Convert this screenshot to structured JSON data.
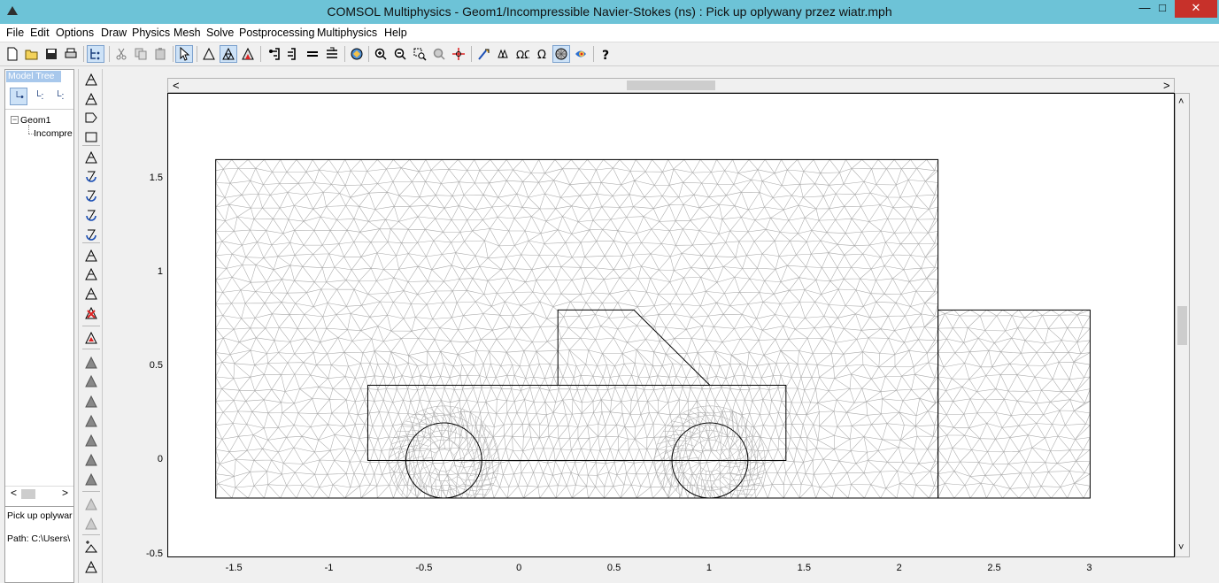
{
  "window": {
    "title": "COMSOL Multiphysics - Geom1/Incompressible Navier-Stokes (ns) : Pick up oplywany przez wiatr.mph",
    "minimize_glyph": "—",
    "maximize_glyph": "□",
    "close_glyph": "✕",
    "app_icon": "comsol-logo-icon"
  },
  "menu": {
    "items": [
      "File",
      "Edit",
      "Options",
      "Draw",
      "Physics",
      "Mesh",
      "Solve",
      "Postprocessing",
      "Multiphysics",
      "Help"
    ]
  },
  "toolbar": {
    "buttons": [
      "new-icon",
      "open-icon",
      "save-icon",
      "print-icon",
      "model-tree-icon",
      "cut-icon",
      "copy-icon",
      "paste-icon",
      "select-icon",
      "draw-mode-icon",
      "mesh-mode-icon",
      "postprocess-mode-icon",
      "scroll-icon",
      "zoom-in-step-icon",
      "equal-icon",
      "sub-equal-icon",
      "refresh-icon",
      "zoom-in-icon",
      "zoom-out-icon",
      "zoom-window-icon",
      "zoom-extents-icon",
      "move-icon",
      "plot-parameters-icon",
      "initialize-mesh-icon",
      "refine-mesh-icon",
      "omega-icon",
      "mesh-visible-icon",
      "color-plot-icon",
      "help-icon"
    ],
    "pressed": [
      "model-tree-icon",
      "select-icon",
      "mesh-mode-icon",
      "mesh-visible-icon"
    ]
  },
  "model_tree": {
    "header": "Model Tree",
    "tabs": [
      "└•",
      "└:",
      "└:"
    ],
    "nodes": [
      {
        "label": "Geom1",
        "expander": "−"
      },
      {
        "label": "Incompre"
      }
    ],
    "scroll_left": "<",
    "scroll_right": ">",
    "model_name": "Pick up oplywar",
    "path": "Path: C:\\Users\\"
  },
  "drawbar": {
    "buttons": [
      "draw-line-icon",
      "draw-triangle-icon",
      "draw-polygon-icon",
      "draw-square-icon",
      "mesh-boundary-icon",
      "rotate-mesh-icon",
      "rotate-mesh-2-icon",
      "rotate-mesh-3-icon",
      "rotate-mesh-4-icon",
      "extrude-mesh-icon",
      "refine-tri-icon",
      "refine-tri-2-icon",
      "delete-mesh-icon",
      "mesh-stats-icon",
      "solid-triangle-icon",
      "solid-flag-icon",
      "solid-square-icon",
      "solid-house-icon",
      "solid-triangle-2-icon",
      "solid-triangle-3-icon",
      "solid-triangle-4-icon",
      "outline-triangle-icon",
      "outline-triangle-2-icon",
      "add-point-icon",
      "edge-triangle-icon"
    ]
  },
  "canvas": {
    "scroll_left": "<",
    "scroll_right": ">",
    "scroll_up": "˄",
    "scroll_down": "˅",
    "x_ticks": [
      "-1.5",
      "-1",
      "-0.5",
      "0",
      "0.5",
      "1",
      "1.5",
      "2",
      "2.5",
      "3"
    ],
    "y_ticks": [
      "1.5",
      "1",
      "0.5",
      "0",
      "-0.5"
    ],
    "x_tick_values": [
      -1.5,
      -1,
      -0.5,
      0,
      0.5,
      1,
      1.5,
      2,
      2.5,
      3
    ],
    "y_tick_values": [
      1.5,
      1,
      0.5,
      0,
      -0.5
    ],
    "xlim": [
      -1.85,
      3.45
    ],
    "ylim": [
      -0.52,
      1.95
    ],
    "mesh_color": "#a9a9a9",
    "edge_color": "#000000",
    "geometry": {
      "domain_main": [
        [
          -1.6,
          -0.2
        ],
        [
          2.2,
          1.6
        ]
      ],
      "domain_right": [
        [
          2.2,
          -0.2
        ],
        [
          3.0,
          0.8
        ]
      ],
      "body": [
        [
          -0.8,
          0.0
        ],
        [
          1.4,
          0.4
        ]
      ],
      "cabin": [
        [
          0.2,
          0.4
        ],
        [
          0.2,
          0.8
        ],
        [
          0.6,
          0.8
        ],
        [
          1.0,
          0.4
        ]
      ],
      "wheels": [
        {
          "cx": -0.4,
          "cy": 0.0,
          "r": 0.2
        },
        {
          "cx": 1.0,
          "cy": 0.0,
          "r": 0.2
        }
      ]
    }
  }
}
